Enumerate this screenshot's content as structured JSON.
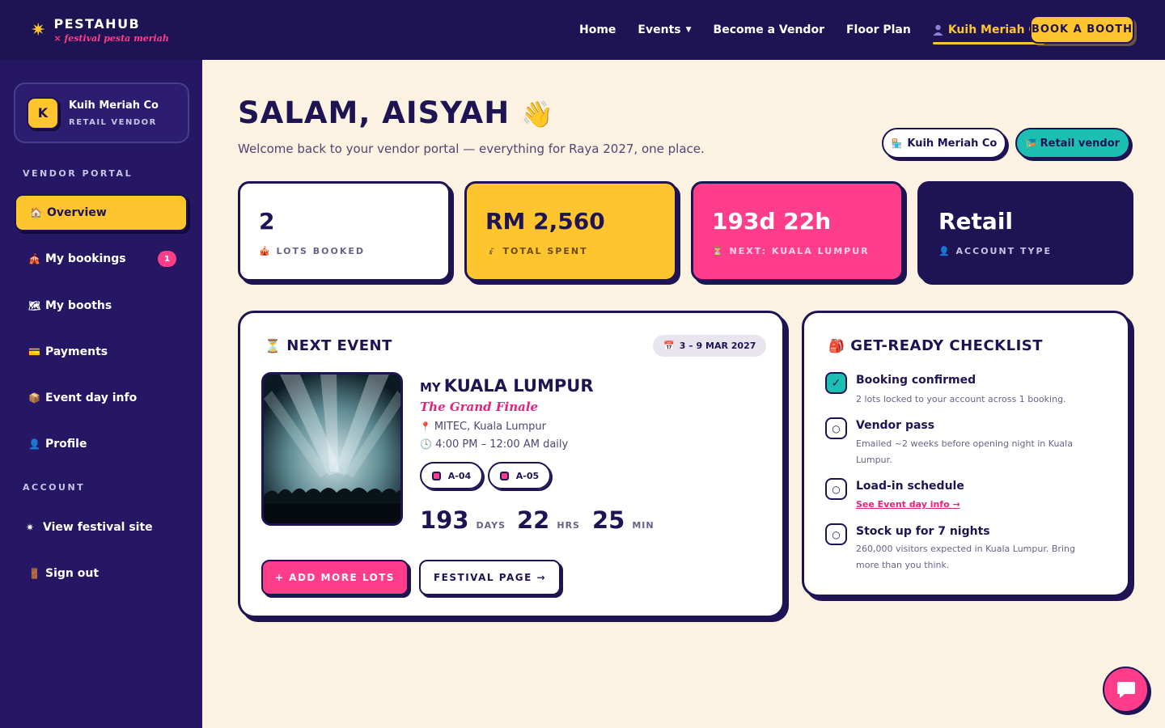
{
  "brand": {
    "name": "PESTAHUB",
    "tagline": "× festival pesta meriah"
  },
  "nav": {
    "links": [
      "Home",
      "Events",
      "Become a Vendor",
      "Floor Plan",
      "Kuih Meriah Co"
    ],
    "cta": "BOOK A BOOTH"
  },
  "sidebar": {
    "account": {
      "initial": "K",
      "name": "Kuih Meriah Co",
      "role": "RETAIL VENDOR"
    },
    "section_portal": "VENDOR PORTAL",
    "items": [
      {
        "label": "Overview",
        "icon": "home-icon"
      },
      {
        "label": "My bookings",
        "icon": "tent-icon",
        "badge": "1"
      },
      {
        "label": "My booths",
        "icon": "map-icon"
      },
      {
        "label": "Payments",
        "icon": "card-icon"
      },
      {
        "label": "Event day info",
        "icon": "box-icon"
      },
      {
        "label": "Profile",
        "icon": "user-icon"
      }
    ],
    "section_account": "ACCOUNT",
    "account_items": [
      {
        "label": "View festival site",
        "icon": "sparkle-icon"
      },
      {
        "label": "Sign out",
        "icon": "door-icon"
      }
    ]
  },
  "header": {
    "greeting": "SALAM, AISYAH",
    "subtitle": "Welcome back to your vendor portal — everything for Raya 2027, one place.",
    "pill_company": "Kuih Meriah Co",
    "pill_type": "Retail vendor"
  },
  "stats": [
    {
      "value": "2",
      "label": "LOTS BOOKED"
    },
    {
      "value": "RM 2,560",
      "label": "TOTAL SPENT"
    },
    {
      "value": "193d 22h",
      "label": "NEXT: KUALA LUMPUR"
    },
    {
      "value": "Retail",
      "label": "ACCOUNT TYPE"
    }
  ],
  "next_event": {
    "heading": "NEXT EVENT",
    "date": "3 – 9 MAR 2027",
    "country": "MY",
    "city": "KUALA LUMPUR",
    "subtitle": "The Grand Finale",
    "venue": "MITEC, Kuala Lumpur",
    "hours": "4:00 PM – 12:00 AM daily",
    "lots": [
      "A-04",
      "A-05"
    ],
    "countdown": {
      "days": "193",
      "days_unit": "DAYS",
      "hours": "22",
      "hours_unit": "HRS",
      "mins": "25",
      "mins_unit": "MIN"
    },
    "add_button": "+ ADD MORE LOTS",
    "festival_button": "FESTIVAL PAGE →"
  },
  "checklist": {
    "heading": "GET-READY CHECKLIST",
    "items": [
      {
        "title": "Booking confirmed",
        "desc": "2 lots locked to your account across 1 booking."
      },
      {
        "title": "Vendor pass",
        "desc": "Emailed ~2 weeks before opening night in Kuala Lumpur."
      },
      {
        "title": "Load-in schedule",
        "link": "See Event day info →"
      },
      {
        "title": "Stock up for 7 nights",
        "desc": "260,000 visitors expected in Kuala Lumpur. Bring more than you think."
      }
    ]
  },
  "colors": {
    "navy": "#1e1454",
    "yellow": "#ffc52e",
    "pink": "#ff3d8b",
    "teal": "#1dbfb2",
    "cream": "#fbf2e1"
  }
}
